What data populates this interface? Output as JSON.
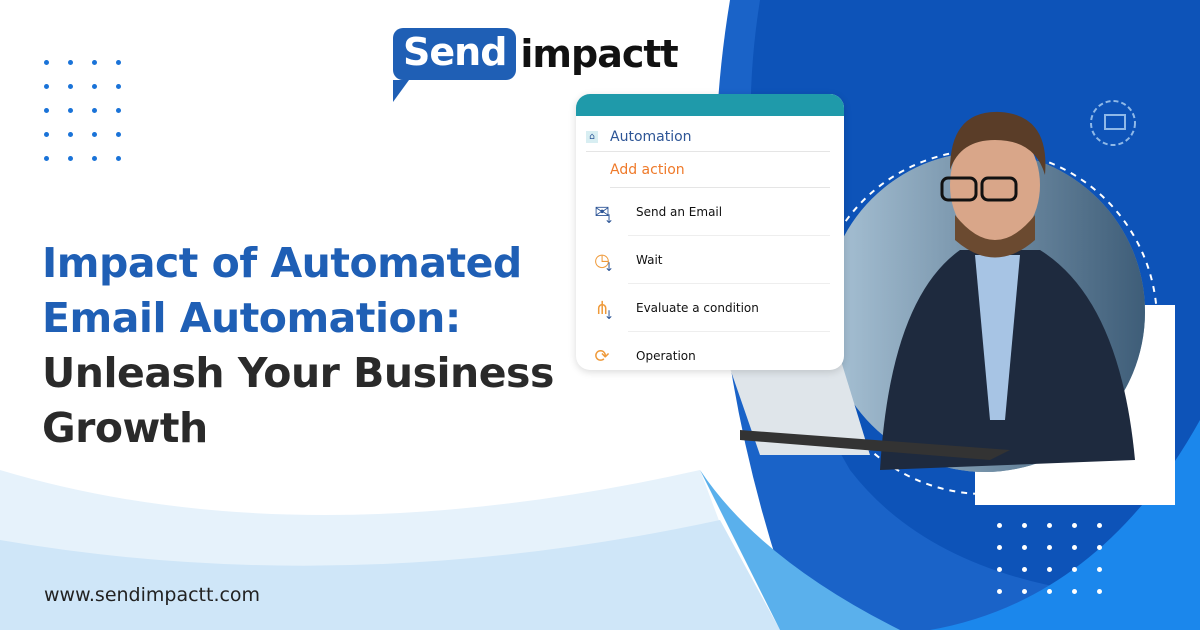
{
  "brand": {
    "logo_part1": "Send",
    "logo_part2": "impactt",
    "primary": "#1f5fb5",
    "accent": "#ef7a2a",
    "teal": "#1f9aaa"
  },
  "headline": {
    "line1": "Impact of Automated",
    "line2": "Email Automation:",
    "line3": "Unleash Your Business",
    "line4": "Growth"
  },
  "card": {
    "title": "Automation",
    "add_action": "Add action",
    "steps": [
      {
        "label": "Send an Email",
        "icon": "email-icon"
      },
      {
        "label": "Wait",
        "icon": "clock-icon"
      },
      {
        "label": "Evaluate a condition",
        "icon": "hierarchy-icon"
      },
      {
        "label": "Operation",
        "icon": "cycle-icon"
      }
    ]
  },
  "footer": {
    "url": "www.sendimpactt.com"
  }
}
